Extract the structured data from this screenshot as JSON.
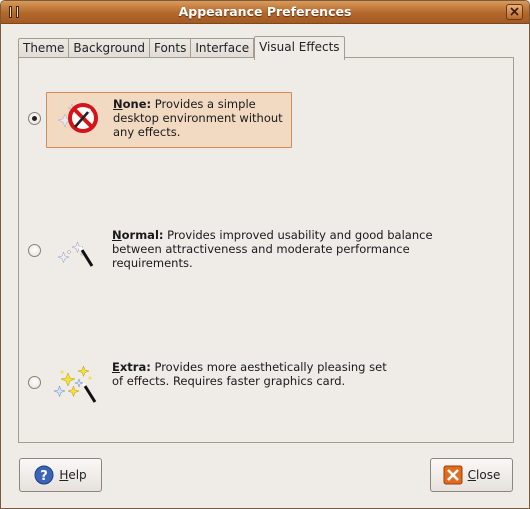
{
  "window": {
    "title": "Appearance Preferences"
  },
  "tabs": [
    {
      "label": "Theme"
    },
    {
      "label": "Background"
    },
    {
      "label": "Fonts"
    },
    {
      "label": "Interface"
    },
    {
      "label": "Visual Effects",
      "active": true
    }
  ],
  "options": [
    {
      "mnemonic": "N",
      "name_rest": "one:",
      "line1": " Provides a simple",
      "line2": "desktop environment without",
      "line3": "any effects.",
      "selected": true,
      "icon": "no-effects-icon"
    },
    {
      "mnemonic": "N",
      "name_rest": "ormal:",
      "line1": " Provides improved usability and good balance",
      "line2": "between attractiveness and moderate performance",
      "line3": "requirements.",
      "selected": false,
      "icon": "magic-wand-icon"
    },
    {
      "mnemonic": "E",
      "name_rest": "xtra:",
      "line1": " Provides more aesthetically pleasing set",
      "line2": "of effects. Requires faster graphics card.",
      "line3": "",
      "selected": false,
      "icon": "sparkle-wand-icon"
    }
  ],
  "buttons": {
    "help": {
      "mnemonic": "H",
      "rest": "elp",
      "icon": "help-icon"
    },
    "close": {
      "mnemonic": "C",
      "rest": "lose",
      "icon": "close-icon"
    }
  },
  "colors": {
    "titlebar": "#b3672b",
    "selection": "#f1d9c2",
    "selection_border": "#cf8c5a"
  }
}
